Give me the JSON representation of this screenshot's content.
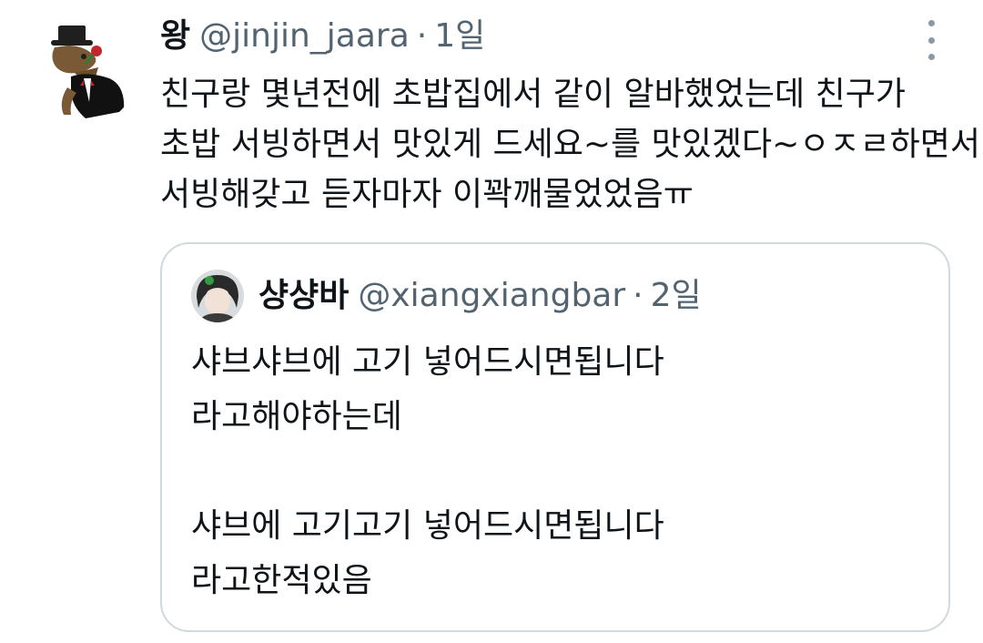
{
  "tweet": {
    "author_name": "왕",
    "author_handle": "@jinjin_jaara",
    "separator": "·",
    "time": "1일",
    "avatar_icon": "tophat-dinosaur-avatar-icon",
    "more_icon": "more-options-icon",
    "text_lines": [
      "친구랑 몇년전에 초밥집에서 같이 알바했었는데 친구가",
      "초밥 서빙하면서 맛있게 드세요~를 맛있겠다~ㅇㅈㄹ하면서",
      "서빙해갖고 듣자마자 이꽉깨물었었음ㅠ"
    ]
  },
  "quote": {
    "author_name": "샹샹바",
    "author_handle": "@xiangxiangbar",
    "separator": "·",
    "time": "2일",
    "avatar_icon": "person-photo-avatar-icon",
    "text_lines": [
      "샤브샤브에 고기 넣어드시면됩니다",
      "라고해야하는데",
      "",
      "샤브에 고기고기 넣어드시면됩니다",
      "라고한적있음"
    ]
  },
  "colors": {
    "text_primary": "#0f1419",
    "text_secondary": "#536471",
    "border": "#cfd9de",
    "background": "#ffffff"
  }
}
